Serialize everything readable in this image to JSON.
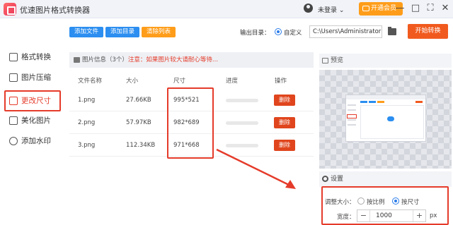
{
  "app": {
    "title": "优速图片格式转换器"
  },
  "header": {
    "user_label": "未登录",
    "vip_label": "开通会员",
    "window_controls": [
      "—",
      "□",
      "⛶",
      "✕"
    ]
  },
  "toolbar": {
    "add_file": "添加文件",
    "add_dir": "添加目录",
    "clear_list": "清除列表",
    "output_label": "输出目录：",
    "output_mode": "自定义",
    "output_path": "C:\\Users\\Administrator",
    "start": "开始转换"
  },
  "sidebar": {
    "items": [
      {
        "label": "格式转换",
        "icon": "convert-icon"
      },
      {
        "label": "图片压缩",
        "icon": "compress-icon"
      },
      {
        "label": "更改尺寸",
        "icon": "resize-icon",
        "active": true
      },
      {
        "label": "美化图片",
        "icon": "beautify-icon"
      },
      {
        "label": "添加水印",
        "icon": "watermark-icon"
      }
    ]
  },
  "file_list": {
    "header": "图片信息（3个）",
    "note": "注意：如果图片较大请耐心等待...",
    "columns": [
      "文件名称",
      "大小",
      "尺寸",
      "进度",
      "操作"
    ],
    "rows": [
      {
        "name": "1.png",
        "size": "27.66KB",
        "dims": "995*521",
        "progress": 0,
        "action": "删除"
      },
      {
        "name": "2.png",
        "size": "57.97KB",
        "dims": "982*689",
        "progress": 0,
        "action": "删除"
      },
      {
        "name": "3.png",
        "size": "112.34KB",
        "dims": "971*668",
        "progress": 0,
        "action": "删除"
      }
    ]
  },
  "preview": {
    "title": "预览"
  },
  "settings": {
    "title": "设置",
    "resize_label": "调整大小：",
    "option_ratio": "按比例",
    "option_size": "按尺寸",
    "selected": "按尺寸",
    "width_label": "宽度：",
    "width_value": "1000",
    "width_unit": "px"
  },
  "colors": {
    "accent_red": "#e53b2a",
    "primary_blue": "#2b8ef0",
    "vip_orange": "#ff9d1a",
    "start_orange": "#f15a1e"
  }
}
